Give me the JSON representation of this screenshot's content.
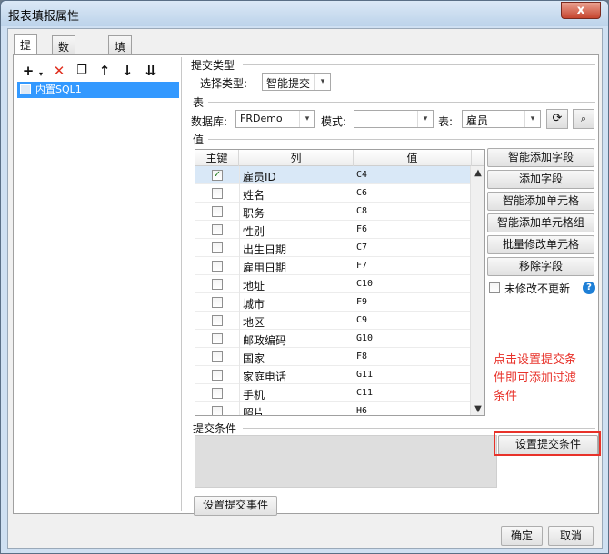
{
  "window": {
    "title": "报表填报属性",
    "close_label": "x"
  },
  "tabs": [
    {
      "label": "提交"
    },
    {
      "label": "数据校验"
    },
    {
      "label": "填报快捷键设置"
    }
  ],
  "toolbar": {
    "icons": [
      "add-icon",
      "delete-icon",
      "copy-icon",
      "move-up-icon",
      "move-down-icon",
      "move-bottom-icon"
    ]
  },
  "tree": {
    "item": "内置SQL1"
  },
  "submit_type": {
    "section": "提交类型",
    "label": "选择类型:",
    "value": "智能提交"
  },
  "table_section": {
    "section": "表",
    "db_label": "数据库:",
    "db_value": "FRDemo",
    "schema_label": "模式:",
    "schema_value": "",
    "table_label": "表:",
    "table_value": "雇员"
  },
  "values": {
    "section": "值",
    "headers": {
      "key": "主键",
      "column": "列",
      "value": "值"
    },
    "rows": [
      {
        "checked": true,
        "column": "雇员ID",
        "value": "C4"
      },
      {
        "checked": false,
        "column": "姓名",
        "value": "C6"
      },
      {
        "checked": false,
        "column": "职务",
        "value": "C8"
      },
      {
        "checked": false,
        "column": "性别",
        "value": "F6"
      },
      {
        "checked": false,
        "column": "出生日期",
        "value": "C7"
      },
      {
        "checked": false,
        "column": "雇用日期",
        "value": "F7"
      },
      {
        "checked": false,
        "column": "地址",
        "value": "C10"
      },
      {
        "checked": false,
        "column": "城市",
        "value": "F9"
      },
      {
        "checked": false,
        "column": "地区",
        "value": "C9"
      },
      {
        "checked": false,
        "column": "邮政编码",
        "value": "G10"
      },
      {
        "checked": false,
        "column": "国家",
        "value": "F8"
      },
      {
        "checked": false,
        "column": "家庭电话",
        "value": "G11"
      },
      {
        "checked": false,
        "column": "手机",
        "value": "C11"
      },
      {
        "checked": false,
        "column": "照片",
        "value": "H6"
      }
    ]
  },
  "side_buttons": {
    "smart_add_field": "智能添加字段",
    "add_field": "添加字段",
    "smart_add_cell": "智能添加单元格",
    "smart_add_cell_group": "智能添加单元格组",
    "batch_modify_cell": "批量修改单元格",
    "remove_field": "移除字段",
    "unchanged_no_update": "未修改不更新",
    "help": "?"
  },
  "annotation": {
    "line1": "点击设置提交条",
    "line2": "件即可添加过滤",
    "line3": "条件"
  },
  "submit_condition": {
    "section": "提交条件",
    "button": "设置提交条件"
  },
  "submit_event": {
    "button": "设置提交事件"
  },
  "footer": {
    "ok": "确定",
    "cancel": "取消"
  },
  "colors": {
    "accent": "#3399ff",
    "annotation": "#e8322a"
  }
}
